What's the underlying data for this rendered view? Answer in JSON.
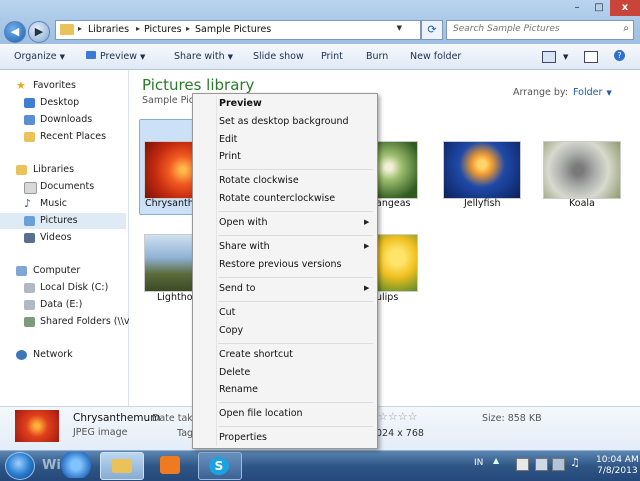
{
  "window": {
    "breadcrumb": [
      "Libraries",
      "Pictures",
      "Sample Pictures"
    ],
    "search_placeholder": "Search Sample Pictures",
    "controls": {
      "minimize": "–",
      "maximize": "□",
      "close": "x"
    }
  },
  "toolbar": {
    "organize": "Organize",
    "preview": "Preview",
    "share_with": "Share with",
    "slide_show": "Slide show",
    "print": "Print",
    "burn": "Burn",
    "new_folder": "New folder"
  },
  "nav": {
    "favorites": "Favorites",
    "desktop": "Desktop",
    "downloads": "Downloads",
    "recent_places": "Recent Places",
    "libraries": "Libraries",
    "documents": "Documents",
    "music": "Music",
    "pictures": "Pictures",
    "videos": "Videos",
    "computer": "Computer",
    "local_disk": "Local Disk (C:)",
    "data": "Data (E:)",
    "shared_folders": "Shared Folders (\\\\vn",
    "network": "Network"
  },
  "content": {
    "title": "Pictures library",
    "subtitle": "Sample Pict",
    "arrange_by_label": "Arrange by:",
    "arrange_by_value": "Folder",
    "files": [
      {
        "name": "Chrysanthe"
      },
      {
        "name": "angeas"
      },
      {
        "name": "Jellyfish"
      },
      {
        "name": "Koala"
      },
      {
        "name": "Lighthou"
      },
      {
        "name": "ulips"
      }
    ]
  },
  "context_menu": {
    "items": [
      "Preview",
      "Set as desktop background",
      "Edit",
      "Print",
      "Rotate clockwise",
      "Rotate counterclockwise",
      "Open with",
      "Share with",
      "Restore previous versions",
      "Send to",
      "Cut",
      "Copy",
      "Create shortcut",
      "Delete",
      "Rename",
      "Open file location",
      "Properties"
    ]
  },
  "details": {
    "name": "Chrysanthemum",
    "type": "JPEG image",
    "date_label": "Date take",
    "tags_label": "Tag",
    "rating_stars": "☆☆☆☆",
    "dimensions": "024 x 768",
    "size": "Size: 858 KB",
    "rating_value": 0
  },
  "taskbar": {
    "lang": "IN",
    "time": "10:04 AM",
    "date": "7/8/2013",
    "watermark": "WinPo"
  },
  "colors": {
    "accent": "#1e5aa8",
    "library_title": "#2a7a2a",
    "close": "#c9453a"
  }
}
